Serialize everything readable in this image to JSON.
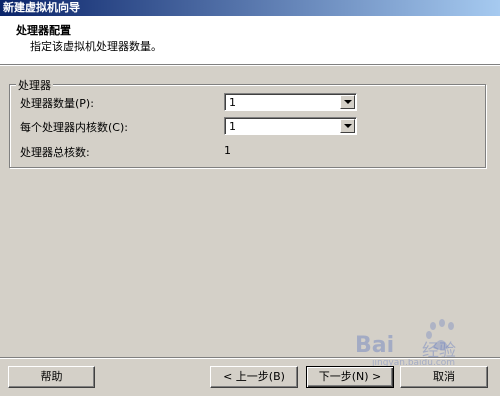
{
  "window": {
    "title": "新建虚拟机向导"
  },
  "header": {
    "title": "处理器配置",
    "description": "指定该虚拟机处理器数量。"
  },
  "processors": {
    "group_label": "处理器",
    "count_label": "处理器数量(P):",
    "count_value": "1",
    "cores_label": "每个处理器内核数(C):",
    "cores_value": "1",
    "total_label": "处理器总核数:",
    "total_value": "1"
  },
  "buttons": {
    "help": "帮助",
    "back": "< 上一步(B)",
    "next": "下一步(N) >",
    "cancel": "取消"
  },
  "watermark": {
    "brand": "Bai",
    "brand2": "经验",
    "url": "jingyan.baidu.com"
  },
  "colors": {
    "face": "#d4d0c8",
    "titlebar_start": "#0a246a",
    "titlebar_end": "#a6caf0",
    "watermark": "#6a7fc0"
  }
}
